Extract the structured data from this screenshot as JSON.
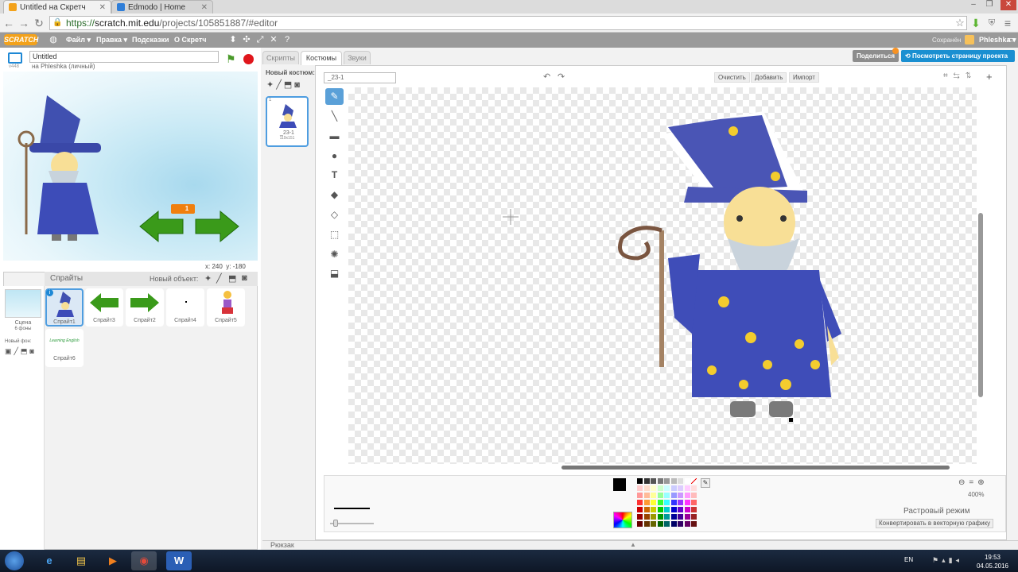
{
  "browser": {
    "tabs": [
      {
        "title": "Untitled на Скретч",
        "active": true
      },
      {
        "title": "Edmodo | Home",
        "active": false
      }
    ],
    "url_scheme": "https://",
    "url_host": "scratch.mit.edu",
    "url_path": "/projects/105851887/#editor"
  },
  "menu": {
    "logo": "SCRATCH",
    "file": "Файл ▾",
    "edit": "Правка ▾",
    "tips": "Подсказки",
    "about": "О Скретч",
    "saved": "Сохранён",
    "user": "Phleshka ▾"
  },
  "stage": {
    "version": "v448",
    "project_title": "Untitled",
    "author": "на Phleshka (личный)",
    "badge": "1",
    "coord_x_label": "x:",
    "coord_x": "240",
    "coord_y_label": "y:",
    "coord_y": "-180"
  },
  "sprites": {
    "header": "Спрайты",
    "new_object": "Новый объект:",
    "scene_label": "Сцена",
    "scene_backdrops": "6 фоны",
    "new_backdrop": "Новый фон:",
    "items": [
      {
        "name": "Спрайт1",
        "selected": true
      },
      {
        "name": "Спрайт3"
      },
      {
        "name": "Спрайт2"
      },
      {
        "name": "Спрайт4"
      },
      {
        "name": "Спрайт5"
      },
      {
        "name": "Спрайт6",
        "caption": "Learning English"
      }
    ]
  },
  "editor": {
    "tabs": [
      "Скрипты",
      "Костюмы",
      "Звуки"
    ],
    "active_tab": "Костюмы",
    "new_costume": "Новый костюм:",
    "costume": {
      "index": "1",
      "name": "_23-1",
      "size": "119x151"
    },
    "costume_name_value": "_23-1",
    "clear": "Очистить",
    "add": "Добавить",
    "import": "Импорт",
    "share": "Поделиться",
    "see_project": "Посмотреть страницу проекта",
    "zoom": "400%",
    "mode": "Растровый режим",
    "convert": "Конвертировать в векторную графику",
    "backpack": "Рюкзак"
  },
  "taskbar": {
    "lang": "EN",
    "time": "19:53",
    "date": "04.05.2016"
  },
  "colors": {
    "menu_bg": "#9a9a9a",
    "accent": "#4e9de0",
    "scratch_orange": "#f3a21b",
    "share_bg": "#8d8d8d",
    "see_project_bg": "#1a8fd1"
  }
}
